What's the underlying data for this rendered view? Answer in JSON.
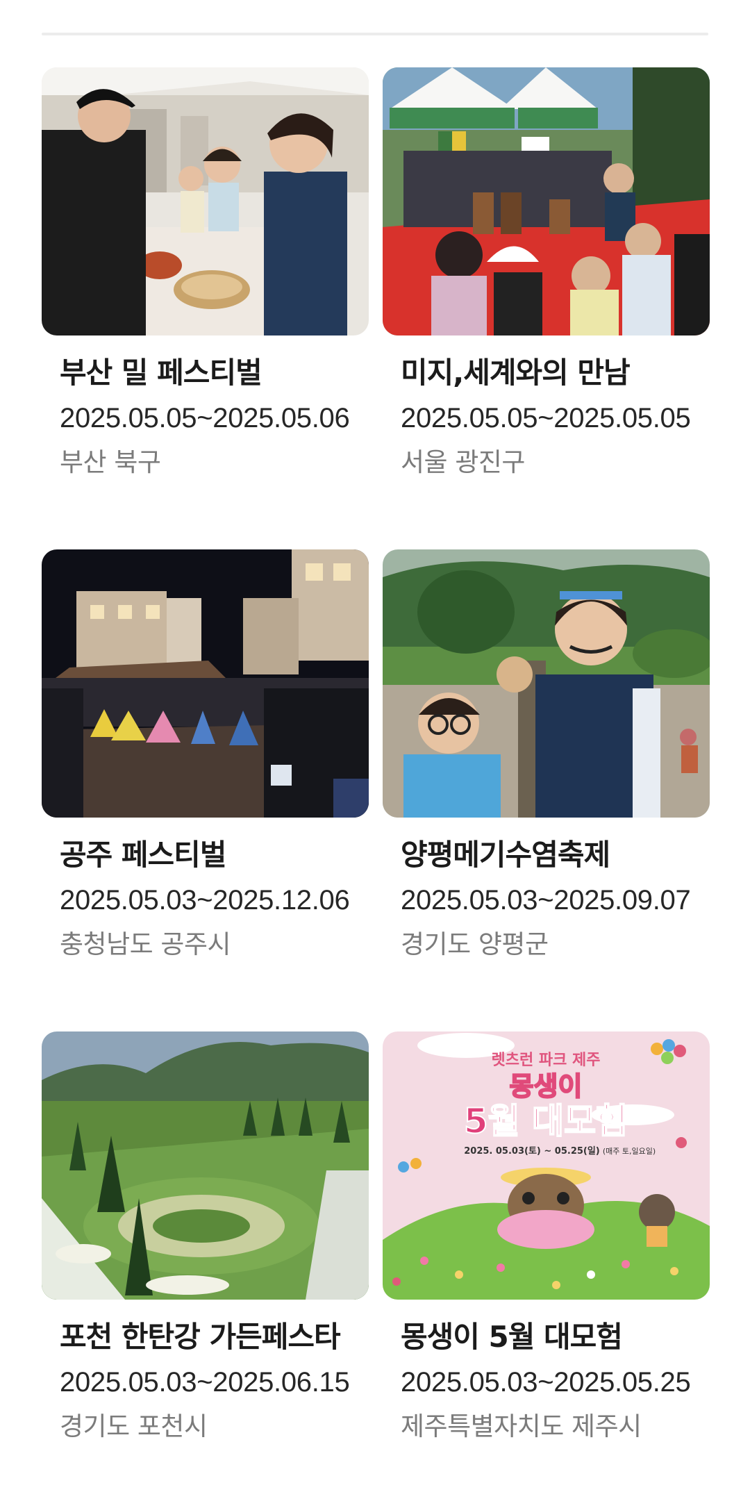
{
  "festivals": [
    {
      "title": "부산 밀 페스티벌",
      "date": "2025.05.05~2025.05.06",
      "region": "부산 북구",
      "image": "cooking-tent-photo"
    },
    {
      "title": "미지,세계와의 만남",
      "date": "2025.05.05~2025.05.05",
      "region": "서울 광진구",
      "image": "drum-performance-photo"
    },
    {
      "title": "공주 페스티벌",
      "date": "2025.05.03~2025.12.06",
      "region": "충청남도 공주시",
      "image": "night-parade-photo"
    },
    {
      "title": "양평메기수염축제",
      "date": "2025.05.03~2025.09.07",
      "region": "경기도 양평군",
      "image": "catfish-kids-photo"
    },
    {
      "title": "포천 한탄강 가든페스타",
      "date": "2025.05.03~2025.06.15",
      "region": "경기도 포천시",
      "image": "garden-photo"
    },
    {
      "title": "몽생이 5월 대모험",
      "date": "2025.05.03~2025.05.25",
      "region": "제주특별자치도 제주시",
      "image": "poster-illustration"
    }
  ],
  "poster": {
    "brand": "렛츠런 파크 제주",
    "line1": "몽생이",
    "line2": "5월 대모험",
    "dates": "2025. 05.03(토) ~ 05.25(일)",
    "days": "(매주 토,일요일)"
  }
}
